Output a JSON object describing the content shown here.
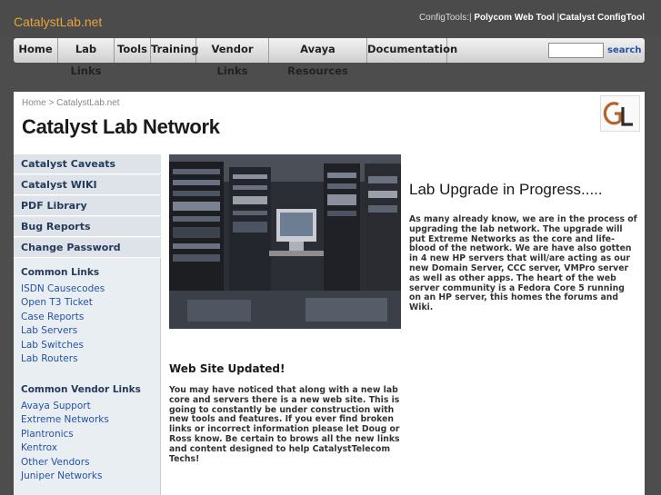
{
  "site": {
    "logo_text": "CatalystLab.net"
  },
  "config_tools": {
    "lead": "ConfigTools:|",
    "links": [
      "Polycom Web Tool",
      "Catalyst ConfigTool"
    ],
    "separator": " |"
  },
  "nav": {
    "items": [
      "Home",
      "Lab Links",
      "Tools",
      "Training",
      "Vendor Links",
      "Avaya Resources",
      "Documentation"
    ]
  },
  "search": {
    "value": "",
    "button_label": "search"
  },
  "breadcrumb": {
    "home": "Home",
    "sep": " > ",
    "current": "CatalystLab.net"
  },
  "page": {
    "title": "Catalyst Lab Network"
  },
  "sidebar": {
    "buttons": [
      "Catalyst Caveats",
      "Catalyst WIKI",
      "PDF Library",
      "Bug Reports",
      "Change Password"
    ],
    "common_heading": "Common Links",
    "common_links": [
      "ISDN Causecodes",
      "Open T3 Ticket",
      "Case Reports",
      "Lab Servers",
      "Lab Switches",
      "Lab Routers"
    ],
    "vendor_heading": "Common Vendor Links",
    "vendor_links": [
      "Avaya Support",
      "Extreme Networks",
      "Plantronics",
      "Kentrox",
      "Other Vendors",
      "Juniper Networks"
    ]
  },
  "main": {
    "upgrade_title": "Lab Upgrade in Progress.....",
    "upgrade_text": "As many already know, we are in the process of upgrading the lab network. The upgrade will put Extreme Networks as the core and life-blood of the network. We are have also gotten in 4 new HP servers that will/are acting as our new Domain Server, CCC server, VMPro server as well as other apps. The heart of the web server community is a Fedora Core 5 running on an HP server, this homes the forums and Wiki.",
    "updated_title": "Web Site Updated!",
    "updated_text": "You may have noticed that along with a new lab core and servers there is a new web site. This is going to constantly be under construction with new tools and features. If you ever find broken links or incorrect information please let Doug or Ross know. Be certain to brows all the new links and content designed to help CatalystTelecom Techs!"
  },
  "colors": {
    "logo": "#e8a33a",
    "link": "#2552a3",
    "sidebar_text": "#263a5a",
    "background": "#4d4d4d"
  },
  "icons": {
    "logo_badge": "gl-monogram-logo",
    "photo": "server-racks-photo"
  }
}
